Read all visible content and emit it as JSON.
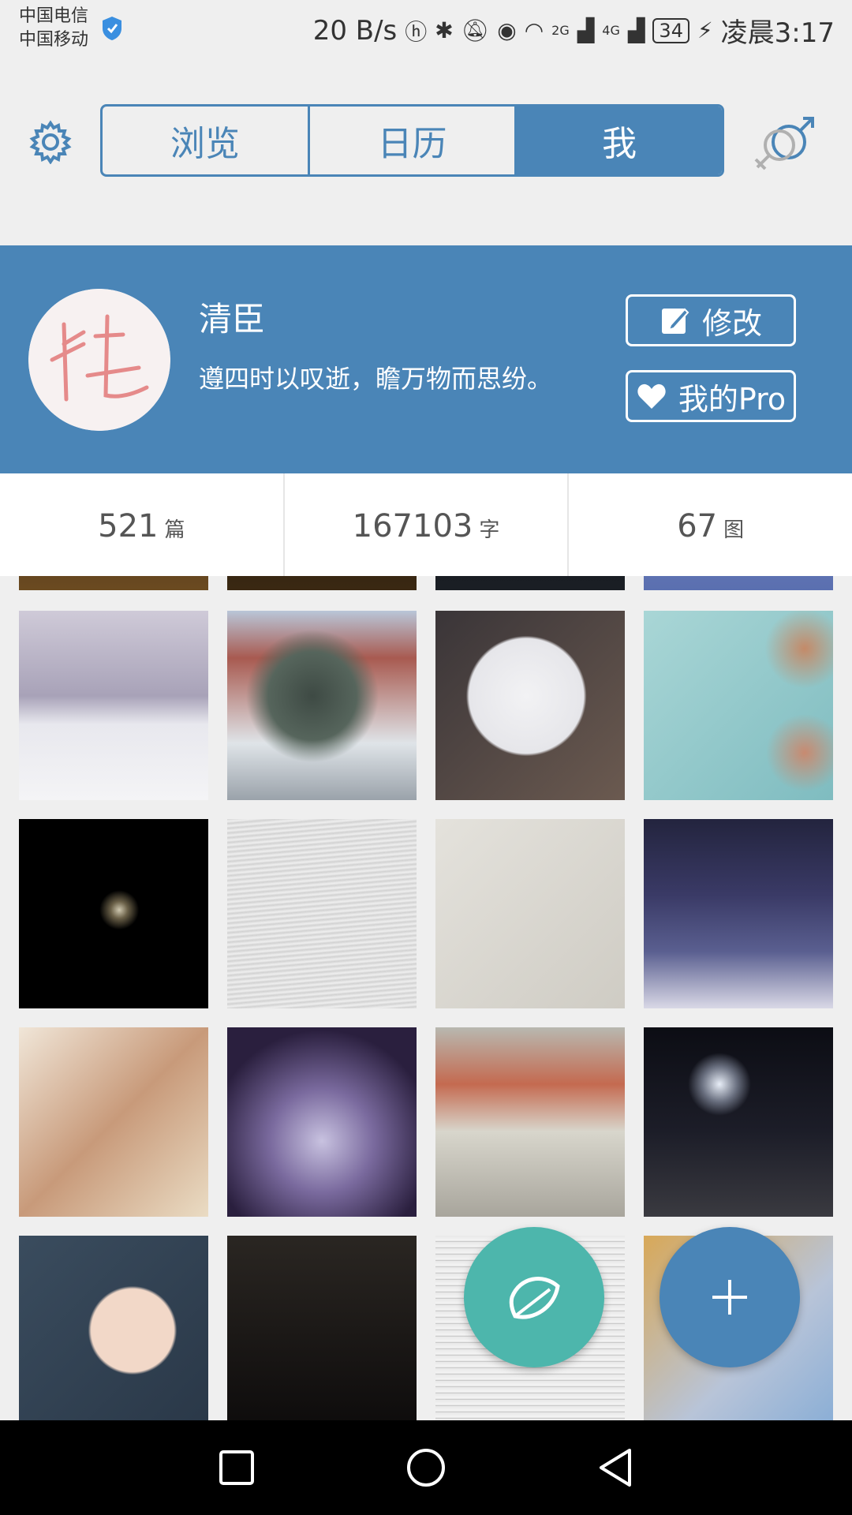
{
  "status_bar": {
    "carrier_1": "中国电信",
    "carrier_2": "中国移动",
    "speed": "20 B/s",
    "network_2g": "2G",
    "network_4g": "4G",
    "battery": "34",
    "time": "凌晨3:17"
  },
  "tabs": [
    {
      "label": "浏览",
      "active": false
    },
    {
      "label": "日历",
      "active": false
    },
    {
      "label": "我",
      "active": true
    }
  ],
  "profile": {
    "name": "清臣",
    "bio": "遵四时以叹逝，瞻万物而思纷。",
    "edit_label": "修改",
    "pro_label": "我的Pro"
  },
  "stats": [
    {
      "value": "521",
      "unit": "篇"
    },
    {
      "value": "167103",
      "unit": "字"
    },
    {
      "value": "67",
      "unit": "图"
    }
  ],
  "colors": {
    "primary": "#4a85b7",
    "teal_fab": "#4db6ac"
  },
  "icons": {
    "settings": "gear-icon",
    "gender": "gender-icon",
    "leaf_fab": "leaf-icon",
    "add_fab": "plus-icon"
  }
}
